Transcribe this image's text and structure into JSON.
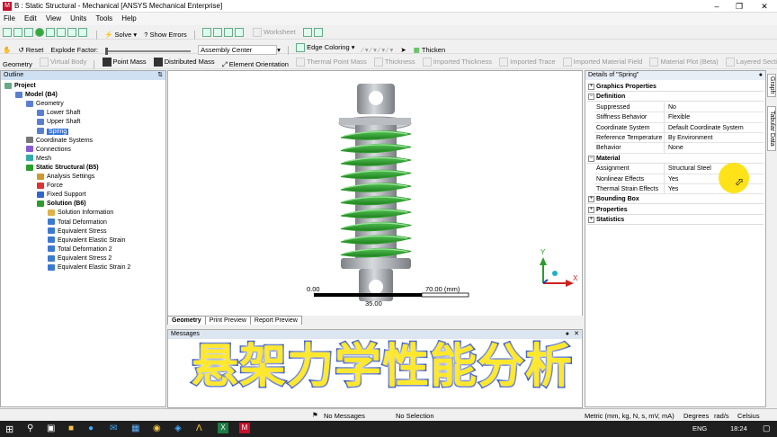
{
  "window": {
    "title": "B : Static Structural - Mechanical [ANSYS Mechanical Enterprise]",
    "app_icon": "M"
  },
  "menu": [
    "File",
    "Edit",
    "View",
    "Units",
    "Tools",
    "Help"
  ],
  "toolbar1": {
    "solve": "Solve",
    "show_errors": "Show Errors",
    "worksheet": "Worksheet"
  },
  "toolbar2": {
    "reset": "Reset",
    "explode_factor": "Explode Factor:",
    "assembly_center": "Assembly Center",
    "edge_coloring": "Edge Coloring",
    "thicken": "Thicken"
  },
  "toolbar3": [
    "Geometry",
    "Virtual Body",
    "Point Mass",
    "Distributed Mass",
    "Element Orientation",
    "Thermal Point Mass",
    "Thickness",
    "Imported Thickness",
    "Imported Trace",
    "Imported Material Field",
    "Material Plot (Beta)",
    "Layered Section"
  ],
  "toolbar3_disabled": [
    false,
    true,
    false,
    false,
    false,
    true,
    true,
    true,
    true,
    true,
    true,
    true
  ],
  "outline": {
    "header": "Outline",
    "items": [
      {
        "label": "Project",
        "level": 0,
        "bold": true,
        "icon": "project-icon"
      },
      {
        "label": "Model (B4)",
        "level": 1,
        "bold": true,
        "icon": "model-icon"
      },
      {
        "label": "Geometry",
        "level": 2,
        "bold": false,
        "icon": "geometry-icon"
      },
      {
        "label": "Lower Shaft",
        "level": 3,
        "bold": false,
        "icon": "body-icon"
      },
      {
        "label": "Upper Shaft",
        "level": 3,
        "bold": false,
        "icon": "body-icon"
      },
      {
        "label": "Spring",
        "level": 3,
        "bold": false,
        "icon": "body-icon",
        "selected": true
      },
      {
        "label": "Coordinate Systems",
        "level": 2,
        "bold": false,
        "icon": "coordinate-icon"
      },
      {
        "label": "Connections",
        "level": 2,
        "bold": false,
        "icon": "connections-icon"
      },
      {
        "label": "Mesh",
        "level": 2,
        "bold": false,
        "icon": "mesh-icon"
      },
      {
        "label": "Static Structural (B5)",
        "level": 2,
        "bold": true,
        "icon": "analysis-icon"
      },
      {
        "label": "Analysis Settings",
        "level": 3,
        "bold": false,
        "icon": "settings-icon"
      },
      {
        "label": "Force",
        "level": 3,
        "bold": false,
        "icon": "force-icon"
      },
      {
        "label": "Fixed Support",
        "level": 3,
        "bold": false,
        "icon": "support-icon"
      },
      {
        "label": "Solution (B6)",
        "level": 3,
        "bold": true,
        "icon": "solution-icon"
      },
      {
        "label": "Solution Information",
        "level": 4,
        "bold": false,
        "icon": "info-icon"
      },
      {
        "label": "Total Deformation",
        "level": 4,
        "bold": false,
        "icon": "result-icon"
      },
      {
        "label": "Equivalent Stress",
        "level": 4,
        "bold": false,
        "icon": "result-icon"
      },
      {
        "label": "Equivalent Elastic Strain",
        "level": 4,
        "bold": false,
        "icon": "result-icon"
      },
      {
        "label": "Total Deformation 2",
        "level": 4,
        "bold": false,
        "icon": "result-icon"
      },
      {
        "label": "Equivalent Stress 2",
        "level": 4,
        "bold": false,
        "icon": "result-icon"
      },
      {
        "label": "Equivalent Elastic Strain 2",
        "level": 4,
        "bold": false,
        "icon": "result-icon"
      }
    ]
  },
  "viewport": {
    "scale_left": "0.00",
    "scale_right": "70.00 (mm)",
    "scale_mid": "35.00",
    "axis_y": "Y",
    "axis_x": "X",
    "tabs": [
      "Geometry",
      "Print Preview",
      "Report Preview"
    ]
  },
  "messages": {
    "header": "Messages"
  },
  "details": {
    "header": "Details of \"Spring\"",
    "groups": [
      {
        "title": "Graphics Properties",
        "expanded": false,
        "rows": []
      },
      {
        "title": "Definition",
        "expanded": true,
        "rows": [
          {
            "k": "Suppressed",
            "v": "No"
          },
          {
            "k": "Stiffness Behavior",
            "v": "Flexible"
          },
          {
            "k": "Coordinate System",
            "v": "Default Coordinate System"
          },
          {
            "k": "Reference Temperature",
            "v": "By Environment"
          },
          {
            "k": "Behavior",
            "v": "None"
          }
        ]
      },
      {
        "title": "Material",
        "expanded": true,
        "rows": [
          {
            "k": "Assignment",
            "v": "Structural Steel"
          },
          {
            "k": "Nonlinear Effects",
            "v": "Yes"
          },
          {
            "k": "Thermal Strain Effects",
            "v": "Yes"
          }
        ]
      },
      {
        "title": "Bounding Box",
        "expanded": false,
        "rows": []
      },
      {
        "title": "Properties",
        "expanded": false,
        "rows": []
      },
      {
        "title": "Statistics",
        "expanded": false,
        "rows": []
      }
    ]
  },
  "side_tabs": [
    "Graph",
    "Tabular Data"
  ],
  "status": {
    "messages": "No Messages",
    "selection": "No Selection",
    "units": "Metric (mm, kg, N, s, mV, mA)",
    "degrees": "Degrees",
    "rads": "rad/s",
    "celsius": "Celsius"
  },
  "taskbar": {
    "lang": "ENG",
    "time": "18:24"
  },
  "banner": {
    "text": "悬架力学性能分析"
  },
  "colors": {
    "spring_green": "#2e9e2e",
    "shaft_gray": "#9a9ea3",
    "banner_fill": "#ffe82e",
    "banner_stroke": "#1b3fb0",
    "outline_header": "#cfe0f3"
  }
}
